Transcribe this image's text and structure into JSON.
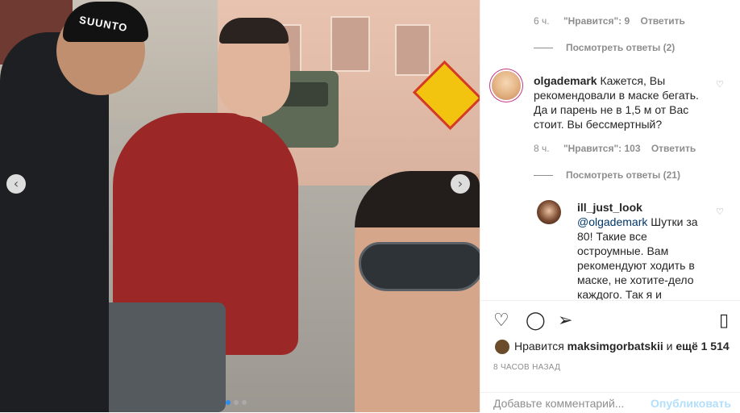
{
  "photo": {
    "hat_text": "SUUNTO",
    "prev_icon": "chevron-left-icon",
    "next_icon": "chevron-right-icon",
    "prev_glyph": "‹",
    "next_glyph": "›"
  },
  "comments": {
    "top_meta": {
      "time": "6 ч.",
      "likes": "\"Нравится\": 9",
      "reply": "Ответить"
    },
    "top_view_replies": "Посмотреть ответы (2)",
    "main": {
      "user": "olgademark",
      "text": "Кажется, Вы рекомендовали в маске бегать. Да и парень не в 1,5 м от Вас стоит. Вы бессмертный?",
      "time": "8 ч.",
      "likes": "\"Нравится\": 103",
      "reply": "Ответить",
      "view_replies": "Посмотреть ответы (21)"
    },
    "reply": {
      "user": "ill_just_look",
      "mention": "@olgademark",
      "text": "Шутки за 80! Такие все остроумные. Вам рекомендуют ходить в маске, не хотите-дело каждого. Так я и"
    },
    "heart_glyph": "♡"
  },
  "actions": {
    "like_glyph": "♡",
    "comment_glyph": "◯",
    "share_glyph": "➢",
    "save_glyph": "▯"
  },
  "likes": {
    "prefix": "Нравится",
    "user": "maksimgorbatskii",
    "suffix": "и",
    "more": "ещё 1 514"
  },
  "timestamp": "8 ЧАСОВ НАЗАД",
  "add_comment": {
    "placeholder": "Добавьте комментарий...",
    "post": "Опубликовать"
  },
  "colors": {
    "accent": "#0095f6",
    "post_disabled": "#b2dffc",
    "muted": "#8e8e8e"
  }
}
